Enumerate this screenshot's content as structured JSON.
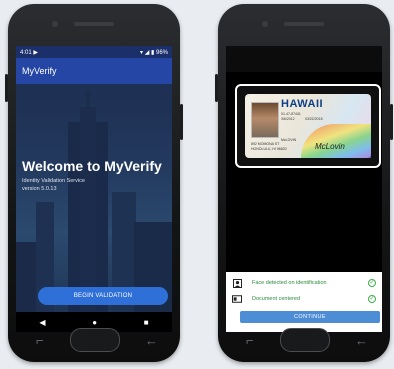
{
  "left_phone": {
    "status": {
      "time": "4:01",
      "left_icon": "play-icon",
      "right_text": "96%"
    },
    "app_title": "MyVerify",
    "welcome_title": "Welcome to MyVerify",
    "subtitle": "Identity Validation Service",
    "version": "version 5.0.13",
    "begin_button": "BEGIN VALIDATION",
    "nav": {
      "back": "◀",
      "home": "●",
      "recents": "■"
    }
  },
  "right_phone": {
    "license": {
      "state": "HAWAII",
      "lines": [
        "01-47-87441",
        "3/6/2012",
        "03/22/2018",
        "McLOVIN",
        "892 MOMONA ST",
        "HONOLULU, HI 96820"
      ],
      "signature": "McLovin"
    },
    "checks": [
      {
        "icon": "portrait-icon",
        "label": "Face detected on identification",
        "status_icon": "check-circle-icon"
      },
      {
        "icon": "id-card-icon",
        "label": "Document centered",
        "status_icon": "check-circle-icon"
      }
    ],
    "continue_button": "CONTINUE"
  },
  "colors": {
    "app_blue": "#2546a5",
    "button_blue": "#2f6fd8",
    "success_green": "#3fae4a",
    "continue_blue": "#4d8dd6"
  }
}
